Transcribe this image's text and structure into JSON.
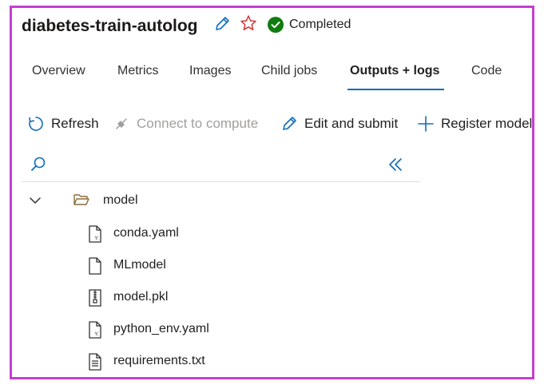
{
  "header": {
    "title": "diabetes-train-autolog",
    "status": "Completed"
  },
  "tabs": [
    "Overview",
    "Metrics",
    "Images",
    "Child jobs",
    "Outputs + logs",
    "Code"
  ],
  "active_tab": "Outputs + logs",
  "toolbar": {
    "refresh": "Refresh",
    "connect": "Connect to compute",
    "edit": "Edit and submit",
    "register": "Register model"
  },
  "tree": {
    "folder": "model",
    "files": [
      "conda.yaml",
      "MLmodel",
      "model.pkl",
      "python_env.yaml",
      "requirements.txt"
    ]
  },
  "colors": {
    "accent": "#0f6cbd",
    "success": "#107c10",
    "favorite": "#d13438",
    "frame": "#c43fd0"
  }
}
